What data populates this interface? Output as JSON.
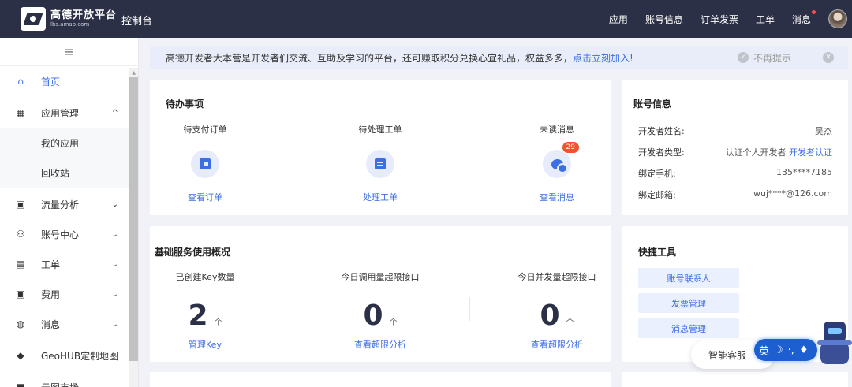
{
  "header": {
    "logo_title": "高德开放平台",
    "logo_sub": "lbs.amap.com",
    "console": "控制台",
    "nav": [
      "应用",
      "账号信息",
      "订单发票",
      "工单",
      "消息"
    ]
  },
  "sidebar": {
    "collapse_icon": "hamburger-icon",
    "items": [
      {
        "label": "首页",
        "icon": "home-icon",
        "glyph": "⌂",
        "active": true
      },
      {
        "label": "应用管理",
        "icon": "grid-icon",
        "glyph": "▦",
        "chevron": "^"
      },
      {
        "label": "我的应用",
        "sub": true
      },
      {
        "label": "回收站",
        "sub": true
      },
      {
        "label": "流量分析",
        "icon": "chart-icon",
        "glyph": "▣",
        "chevron": "⌄"
      },
      {
        "label": "账号中心",
        "icon": "user-icon",
        "glyph": "⚇",
        "chevron": "⌄"
      },
      {
        "label": "工单",
        "icon": "document-icon",
        "glyph": "▤",
        "chevron": "⌄"
      },
      {
        "label": "费用",
        "icon": "money-icon",
        "glyph": "▣",
        "chevron": "⌄"
      },
      {
        "label": "消息",
        "icon": "message-icon",
        "glyph": "◍",
        "chevron": "⌄"
      },
      {
        "label": "GeoHUB定制地图",
        "icon": "layers-icon",
        "glyph": "◆"
      },
      {
        "label": "云图市场",
        "icon": "market-icon",
        "glyph": "■",
        "chevron": "⌄"
      }
    ]
  },
  "notice": {
    "text": "高德开发者大本营是开发者们交流、互助及学习的平台，还可赚取积分兑换心宜礼品，权益多多，",
    "link": "点击立刻加入!",
    "hide": "不再提示"
  },
  "todo": {
    "title": "待办事项",
    "items": [
      {
        "title": "待支付订单",
        "link": "查看订单",
        "icon": "wallet-icon"
      },
      {
        "title": "待处理工单",
        "link": "处理工单",
        "icon": "clipboard-icon"
      },
      {
        "title": "未读消息",
        "link": "查看消息",
        "icon": "chat-icon",
        "badge": "29"
      }
    ]
  },
  "account": {
    "title": "账号信息",
    "rows": [
      {
        "key": "开发者姓名:",
        "value": "吴杰"
      },
      {
        "key": "开发者类型:",
        "value": "认证个人开发者 ",
        "link": "开发者认证"
      },
      {
        "key": "绑定手机:",
        "value": "135****7185"
      },
      {
        "key": "绑定邮箱:",
        "value": "wuj****@126.com"
      }
    ]
  },
  "usage": {
    "title": "基础服务使用概况",
    "items": [
      {
        "title": "已创建Key数量",
        "value": "2",
        "unit": "个",
        "link": "管理Key"
      },
      {
        "title": "今日调用量超限接口",
        "value": "0",
        "unit": "个",
        "link": "查看超限分析"
      },
      {
        "title": "今日并发量超限接口",
        "value": "0",
        "unit": "个",
        "link": "查看超限分析"
      }
    ]
  },
  "tools": {
    "title": "快捷工具",
    "buttons": [
      "账号联系人",
      "发票管理",
      "消息管理"
    ]
  },
  "assistant": {
    "label": "智能客服",
    "ime_label": "英"
  },
  "colors": {
    "primary": "#3c6ee6",
    "topbar": "#2b3046",
    "badge": "#f5512f"
  }
}
